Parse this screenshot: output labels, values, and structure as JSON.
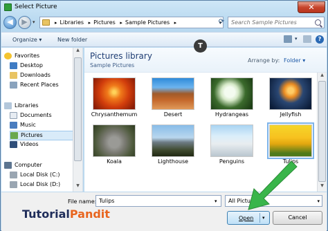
{
  "window": {
    "title": "Select Picture"
  },
  "address": {
    "crumbs": [
      "Libraries",
      "Pictures",
      "Sample Pictures"
    ],
    "search_placeholder": "Search Sample Pictures"
  },
  "toolbar": {
    "organize_label": "Organize ▾",
    "new_folder_label": "New folder"
  },
  "nav": {
    "favorites_label": "Favorites",
    "favorites": [
      "Desktop",
      "Downloads",
      "Recent Places"
    ],
    "libraries_label": "Libraries",
    "libraries": [
      "Documents",
      "Music",
      "Pictures",
      "Videos"
    ],
    "selected": "Pictures",
    "computer_label": "Computer",
    "computer": [
      "Local Disk (C:)",
      "Local Disk (D:)"
    ]
  },
  "library": {
    "title": "Pictures library",
    "subtitle": "Sample Pictures",
    "arrange_label": "Arrange by:",
    "arrange_value": "Folder ▾",
    "items": [
      "Chrysanthemum",
      "Desert",
      "Hydrangeas",
      "Jellyfish",
      "Koala",
      "Lighthouse",
      "Penguins",
      "Tulips"
    ],
    "selected": "Tulips"
  },
  "bottom": {
    "file_name_label": "File name:",
    "file_name_value": "Tulips",
    "file_type_value": "All Pictures",
    "open_label": "Open",
    "cancel_label": "Cancel"
  },
  "branding": {
    "part1": "Tutorial",
    "part2": "Pandit",
    "badge_letter": "T"
  },
  "colors": {
    "accent": "#2a69b4",
    "brand_orange": "#e8651f",
    "brand_navy": "#1f2d5a",
    "arrow_green": "#39b54a"
  },
  "icons": [
    "folder-icon",
    "search-icon",
    "back-arrow-icon",
    "forward-arrow-icon",
    "refresh-icon",
    "help-icon",
    "view-icon",
    "close-icon",
    "star-icon",
    "library-icon",
    "computer-icon",
    "disk-icon"
  ]
}
